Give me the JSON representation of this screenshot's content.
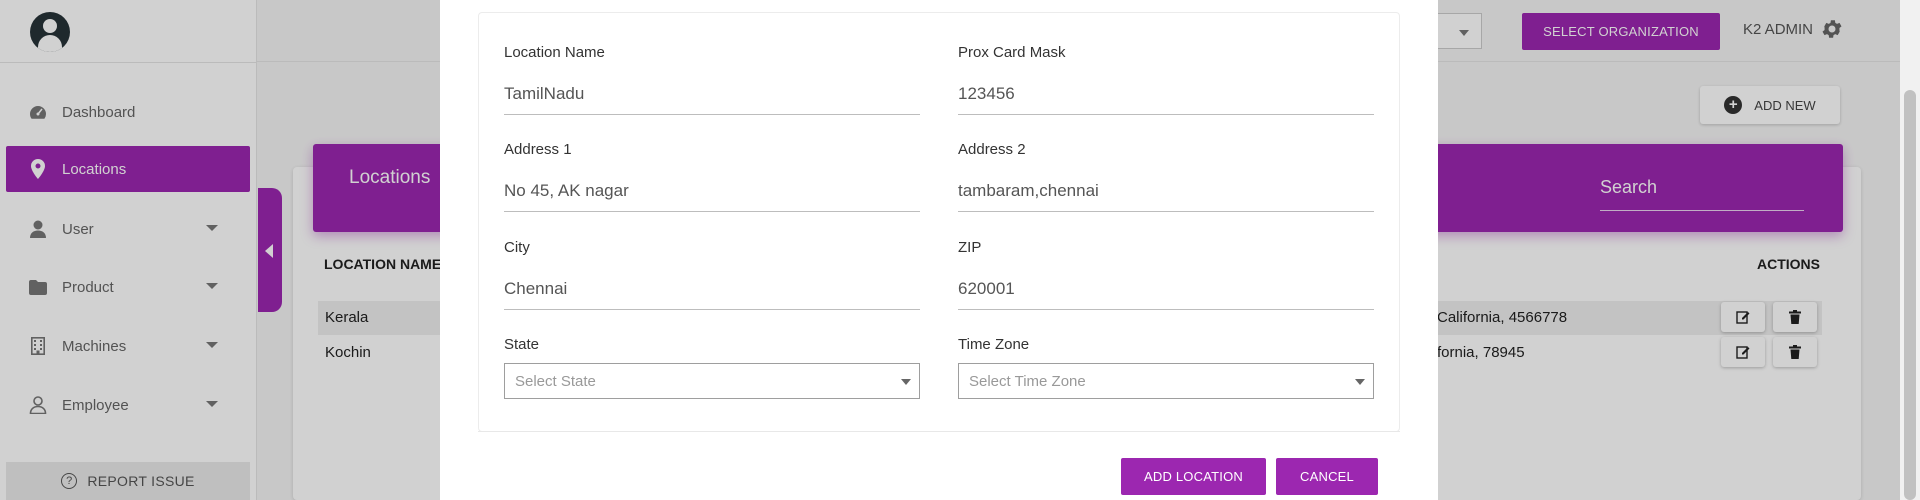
{
  "sidebar": {
    "items": [
      {
        "label": "Dashboard",
        "icon": "dashboard-icon"
      },
      {
        "label": "Locations",
        "icon": "map-pin-icon"
      },
      {
        "label": "User",
        "icon": "user-icon"
      },
      {
        "label": "Product",
        "icon": "folder-icon"
      },
      {
        "label": "Machines",
        "icon": "building-icon"
      },
      {
        "label": "Employee",
        "icon": "person-outline-icon"
      }
    ],
    "report_issue": "REPORT ISSUE"
  },
  "header": {
    "select_org_label": "SELECT ORGANIZATION",
    "admin_label": "K2 ADMIN"
  },
  "main": {
    "add_new_label": "ADD NEW",
    "card_title": "Locations",
    "search_label": "Search",
    "columns": {
      "location_name": "LOCATION NAME",
      "actions": "ACTIONS"
    },
    "rows": [
      {
        "name": "Kerala",
        "address_tail": "California, 4566778"
      },
      {
        "name": "Kochin",
        "address_tail": "fornia, 78945"
      }
    ]
  },
  "modal": {
    "fields": {
      "location_name": {
        "label": "Location Name",
        "value": "TamilNadu"
      },
      "prox_card_mask": {
        "label": "Prox Card Mask",
        "value": "123456"
      },
      "address1": {
        "label": "Address 1",
        "value": "No 45, AK nagar"
      },
      "address2": {
        "label": "Address 2",
        "value": "tambaram,chennai"
      },
      "city": {
        "label": "City",
        "value": "Chennai"
      },
      "zip": {
        "label": "ZIP",
        "value": "620001"
      },
      "state": {
        "label": "State",
        "placeholder": "Select State"
      },
      "time_zone": {
        "label": "Time Zone",
        "placeholder": "Select Time Zone"
      }
    },
    "add_button": "ADD LOCATION",
    "cancel_button": "CANCEL"
  },
  "colors": {
    "accent": "#9c27b0"
  }
}
